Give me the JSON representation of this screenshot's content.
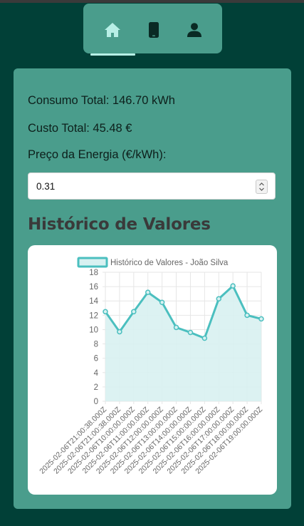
{
  "nav": {
    "items": [
      {
        "icon": "home-icon",
        "active": true
      },
      {
        "icon": "smartphone-icon",
        "active": false
      },
      {
        "icon": "user-icon",
        "active": false
      }
    ],
    "active_color": "#b8efe6",
    "icon_color": "#0a2a24"
  },
  "summary": {
    "consumo_total": "Consumo Total: 146.70 kWh",
    "custo_total": "Custo Total: 45.48 €",
    "preco_label": "Preço da Energia (€/kWh):",
    "preco_value": "0.31"
  },
  "section_title": "Histórico de Valores",
  "colors": {
    "page_bg": "#014037",
    "panel_bg": "#4a9d8c",
    "series_line": "#4bbfbf",
    "series_fill": "#d8f1f1"
  },
  "chart_data": {
    "type": "area",
    "legend": "top",
    "grid": true,
    "ylim": [
      0,
      18
    ],
    "y_ticks": [
      "0",
      "2",
      "4",
      "6",
      "8",
      "10",
      "12",
      "14",
      "16",
      "18"
    ],
    "categories": [
      "2025-02-06T21:00:38.000Z",
      "2025-02-06T21:00:38.000Z",
      "2025-02-06T10:00:00.000Z",
      "2025-02-06T11:00:00.000Z",
      "2025-02-06T12:00:00.000Z",
      "2025-02-06T13:00:00.000Z",
      "2025-02-06T14:00:00.000Z",
      "2025-02-06T15:00:00.000Z",
      "2025-02-06T16:00:00.000Z",
      "2025-02-06T17:00:00.000Z",
      "2025-02-06T18:00:00.000Z",
      "2025-02-06T19:00:00.000Z"
    ],
    "series": [
      {
        "name": "Histórico de Valores - João Silva",
        "values": [
          12.5,
          9.7,
          12.5,
          15.2,
          13.8,
          10.3,
          9.6,
          8.8,
          14.3,
          16.1,
          12.0,
          11.5
        ]
      }
    ]
  }
}
